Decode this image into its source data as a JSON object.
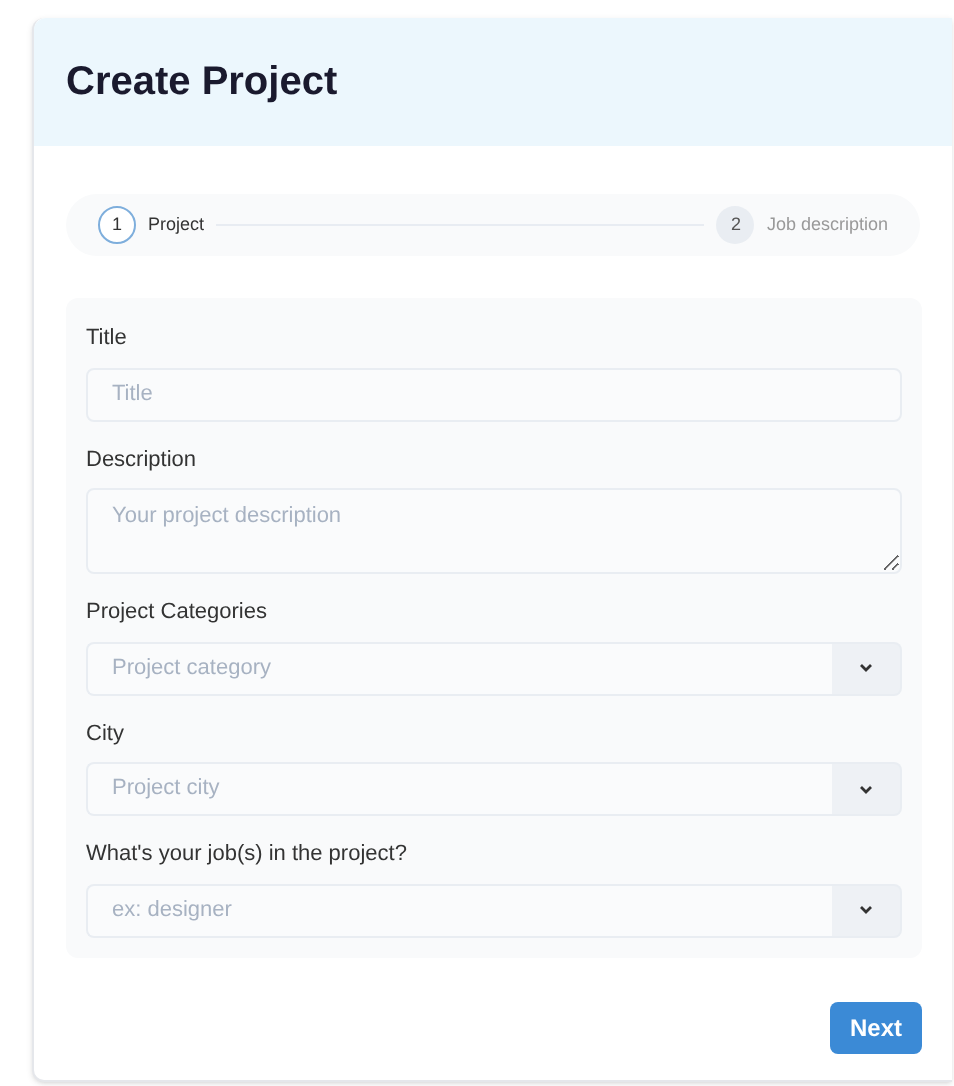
{
  "title": "Create Project",
  "steps": [
    {
      "number": "1",
      "label": "Project",
      "selected": true
    },
    {
      "number": "2",
      "label": "Job description",
      "selected": false
    }
  ],
  "fields": [
    {
      "kind": "input",
      "label": "Title",
      "placeholder": "Title"
    },
    {
      "kind": "textarea",
      "label": "Description",
      "placeholder": "Your project description"
    },
    {
      "kind": "select",
      "label": "Project Categories",
      "placeholder": "Project category"
    },
    {
      "kind": "select",
      "label": "City",
      "placeholder": "Project city"
    },
    {
      "kind": "select",
      "label": "What's your job(s) in the project?",
      "placeholder": "ex: designer"
    }
  ],
  "next_button": "Next"
}
